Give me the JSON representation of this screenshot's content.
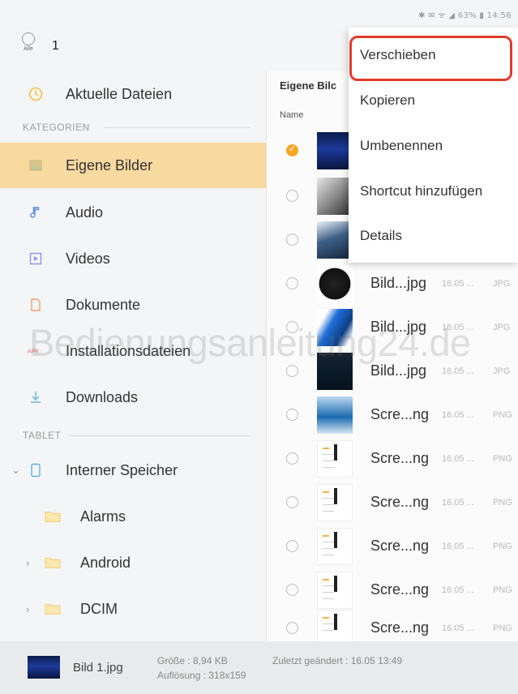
{
  "status_bar": {
    "text": "✱ ✉ ᯤ ◢ 63% ▮ 14:56"
  },
  "top_bar": {
    "select_all_label": "Alle",
    "selected_count": "1"
  },
  "sidebar": {
    "recent": "Aktuelle Dateien",
    "categories_header": "KATEGORIEN",
    "categories": [
      "Eigene Bilder",
      "Audio",
      "Videos",
      "Dokumente",
      "Installationsdateien",
      "Downloads"
    ],
    "tablet_header": "TABLET",
    "storage": "Interner Speicher",
    "folders": [
      "Alarms",
      "Android",
      "DCIM"
    ]
  },
  "main": {
    "breadcrumb": "Eigene Bilc",
    "column_name": "Name",
    "files": [
      {
        "name": "",
        "date": "",
        "type": ""
      },
      {
        "name": "",
        "date": "",
        "type": ""
      },
      {
        "name": "",
        "date": "",
        "type": ""
      },
      {
        "name": "Bild...jpg",
        "date": "16.05 ...",
        "type": "JPG"
      },
      {
        "name": "Bild...jpg",
        "date": "16.05 ...",
        "type": "JPG"
      },
      {
        "name": "Bild...jpg",
        "date": "16.05 ...",
        "type": "JPG"
      },
      {
        "name": "Scre...ng",
        "date": "16.05 ...",
        "type": "PNG"
      },
      {
        "name": "Scre...ng",
        "date": "16.05 ...",
        "type": "PNG"
      },
      {
        "name": "Scre...ng",
        "date": "16.05 ...",
        "type": "PNG"
      },
      {
        "name": "Scre...ng",
        "date": "16.05 ...",
        "type": "PNG"
      },
      {
        "name": "Scre...ng",
        "date": "16.05 ...",
        "type": "PNG"
      },
      {
        "name": "Scre...ng",
        "date": "16.05 ...",
        "type": "PNG"
      }
    ]
  },
  "context_menu": {
    "items": [
      "Verschieben",
      "Kopieren",
      "Umbenennen",
      "Shortcut hinzufügen",
      "Details"
    ]
  },
  "footer": {
    "file_name": "Bild 1.jpg",
    "size": "Größe : 8,94 KB",
    "resolution": "Auflösung : 318x159",
    "modified": "Zuletzt geändert : 16.05 13:49"
  },
  "watermark": "Bedienungsanleitung24.de",
  "colors": {
    "accent": "#f5a623",
    "active_bg": "#f8d9a0",
    "highlight": "#e13b2a"
  }
}
